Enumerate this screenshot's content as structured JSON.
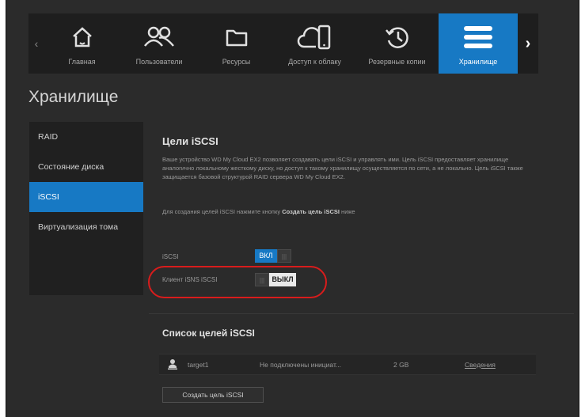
{
  "nav": {
    "items": [
      {
        "label": "Главная",
        "icon": "home-icon"
      },
      {
        "label": "Пользователи",
        "icon": "users-icon"
      },
      {
        "label": "Ресурсы",
        "icon": "folder-icon"
      },
      {
        "label": "Доступ к облаку",
        "icon": "cloud-device-icon"
      },
      {
        "label": "Резервные копии",
        "icon": "backup-clock-icon"
      },
      {
        "label": "Хранилище",
        "icon": "storage-icon"
      }
    ],
    "active": "Хранилище"
  },
  "page_title": "Хранилище",
  "sidebar": {
    "items": [
      {
        "label": "RAID"
      },
      {
        "label": "Состояние диска"
      },
      {
        "label": "iSCSI"
      },
      {
        "label": "Виртуализация тома"
      }
    ],
    "active": "iSCSI"
  },
  "main": {
    "section_title": "Цели iSCSI",
    "description": "Ваше устройство WD My Cloud EX2 позволяет создавать цели iSCSI и управлять ими. Цель iSCSI предоставляет хранилище аналогично локальному жесткому диску, но доступ к такому хранилищу осуществляется по сети, а не локально. Цель iSCSI также защищается базовой структурой RAID сервера WD My Cloud EX2.",
    "hint_prefix": "Для создания целей iSCSI нажмите кнопку",
    "hint_button": "Создать цель iSCSI",
    "hint_suffix": "ниже",
    "iscsi_label": "iSCSI",
    "iscsi_toggle": "ВКЛ",
    "isns_label": "Клиент iSNS iSCSI",
    "isns_toggle": "ВЫКЛ",
    "grip_symbol": "|||",
    "list_title": "Список целей iSCSI",
    "targets": [
      {
        "name": "target1",
        "status": "Не подключены инициат...",
        "size": "2 GB",
        "details": "Сведения"
      }
    ],
    "create_button": "Создать цель iSCSI"
  },
  "colors": {
    "accent": "#1779c4",
    "background": "#2b2b2b",
    "highlight": "#d91c1c"
  }
}
